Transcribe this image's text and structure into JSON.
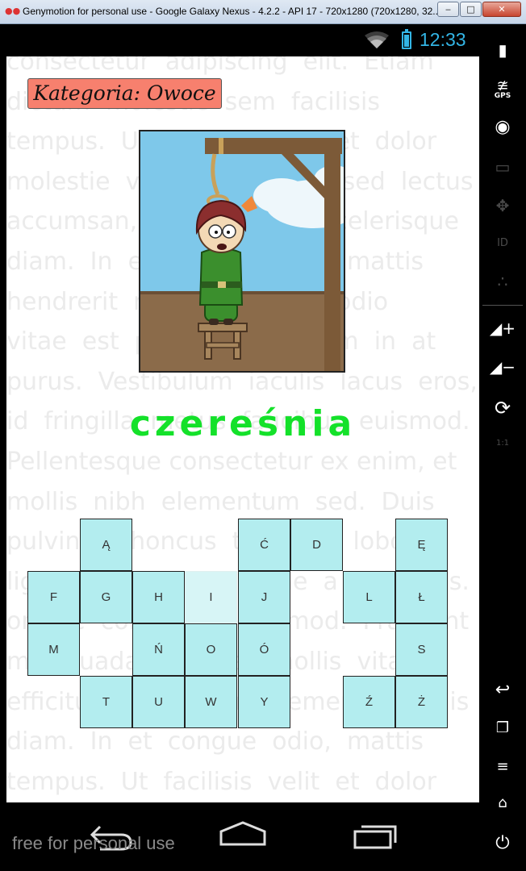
{
  "window": {
    "title": "Genymotion for personal use - Google Galaxy Nexus - 4.2.2 - API 17 - 720x1280 (720x1280, 32...",
    "minimize_label": "‒",
    "maximize_label": "□",
    "close_label": "✕"
  },
  "status_bar": {
    "time": "12:33"
  },
  "app": {
    "category": "Kategoria: Owoce",
    "word": "czereśnia",
    "background_lines": [
      "consectetur  adipiscing  elit.  Etiam",
      "dictum  molestie  sem  facilisis",
      "tempus.  Ut  facilisis  velit  et  dolor",
      "molestie  vitae  consequat  sed  lectus",
      "accumsan,  nec  egestas  scelerisque",
      "diam.  In  et  congue  odio,  mattis",
      "hendrerit  nunc  in  at  vel  odio",
      "vitae  est  pulvinar  interdum  in  at",
      "purus.  Vestibulum  iaculis  lacus  eros,",
      "id  fringilla  metus  faucibus  euismod.",
      "Pellentesque consectetur ex enim, et",
      "mollis  nibh  elementum  sed.  Duis",
      "pulvinar  rhoncus  tellus  at  lobortis",
      "ligula  tincidunt  in  vitae  a  nec  felis.",
      "ornare  commodo  euismod.  Praesent",
      "malesuada  diam  at  mollis  vitae",
      "efficitur  fermentum  elementum  felis",
      "diam.  In  et  congue  odio,  mattis",
      "tempus.  Ut  facilisis  velit  et  dolor"
    ],
    "keys": [
      {
        "label": "Ą",
        "used": false
      },
      {
        "label": "Ć",
        "used": false
      },
      {
        "label": "D",
        "used": false
      },
      {
        "label": "Ę",
        "used": false
      },
      {
        "label": "F",
        "used": false
      },
      {
        "label": "G",
        "used": false
      },
      {
        "label": "H",
        "used": false
      },
      {
        "label": "I",
        "used": true
      },
      {
        "label": "J",
        "used": false
      },
      {
        "label": "L",
        "used": false
      },
      {
        "label": "Ł",
        "used": false
      },
      {
        "label": "M",
        "used": false
      },
      {
        "label": "Ń",
        "used": false
      },
      {
        "label": "O",
        "used": false
      },
      {
        "label": "Ó",
        "used": false
      },
      {
        "label": "S",
        "used": false
      },
      {
        "label": "T",
        "used": false
      },
      {
        "label": "U",
        "used": false
      },
      {
        "label": "W",
        "used": false
      },
      {
        "label": "Y",
        "used": false
      },
      {
        "label": "Ź",
        "used": false
      },
      {
        "label": "Ż",
        "used": false
      }
    ]
  },
  "sidebar": {
    "gps_label": "GPS",
    "ratio_label": "1:1",
    "id_label": "ID"
  },
  "watermark": "free for personal use"
}
